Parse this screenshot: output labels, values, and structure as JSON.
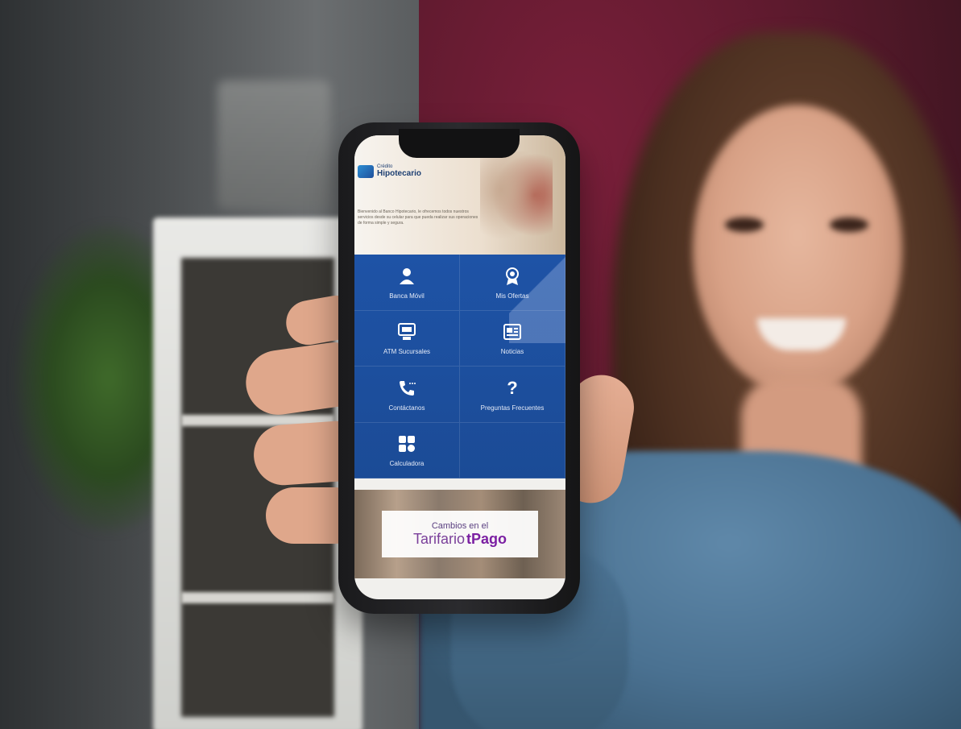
{
  "app": {
    "brand_small": "Crédito",
    "brand_big": "Hipotecario",
    "hero_text": "Bienvenido al Banco Hipotecario, le ofrecemos todos nuestros servicios desde su celular para que pueda realizar sus operaciones de forma simple y segura."
  },
  "menu": {
    "items": [
      {
        "label": "Banca Móvil",
        "icon": "user-bank-icon"
      },
      {
        "label": "Mis Ofertas",
        "icon": "award-icon"
      },
      {
        "label": "ATM Sucursales",
        "icon": "atm-icon"
      },
      {
        "label": "Noticias",
        "icon": "news-icon"
      },
      {
        "label": "Contáctanos",
        "icon": "phone-icon"
      },
      {
        "label": "Preguntas Frecuentes",
        "icon": "question-icon"
      },
      {
        "label": "Calculadora",
        "icon": "calculator-icon"
      }
    ]
  },
  "promo": {
    "line1": "Cambios en el",
    "word1": "Tarifario",
    "word2": "tPago"
  },
  "colors": {
    "menu_blue": "#1e53a6",
    "promo_purple": "#7a3f9a"
  }
}
